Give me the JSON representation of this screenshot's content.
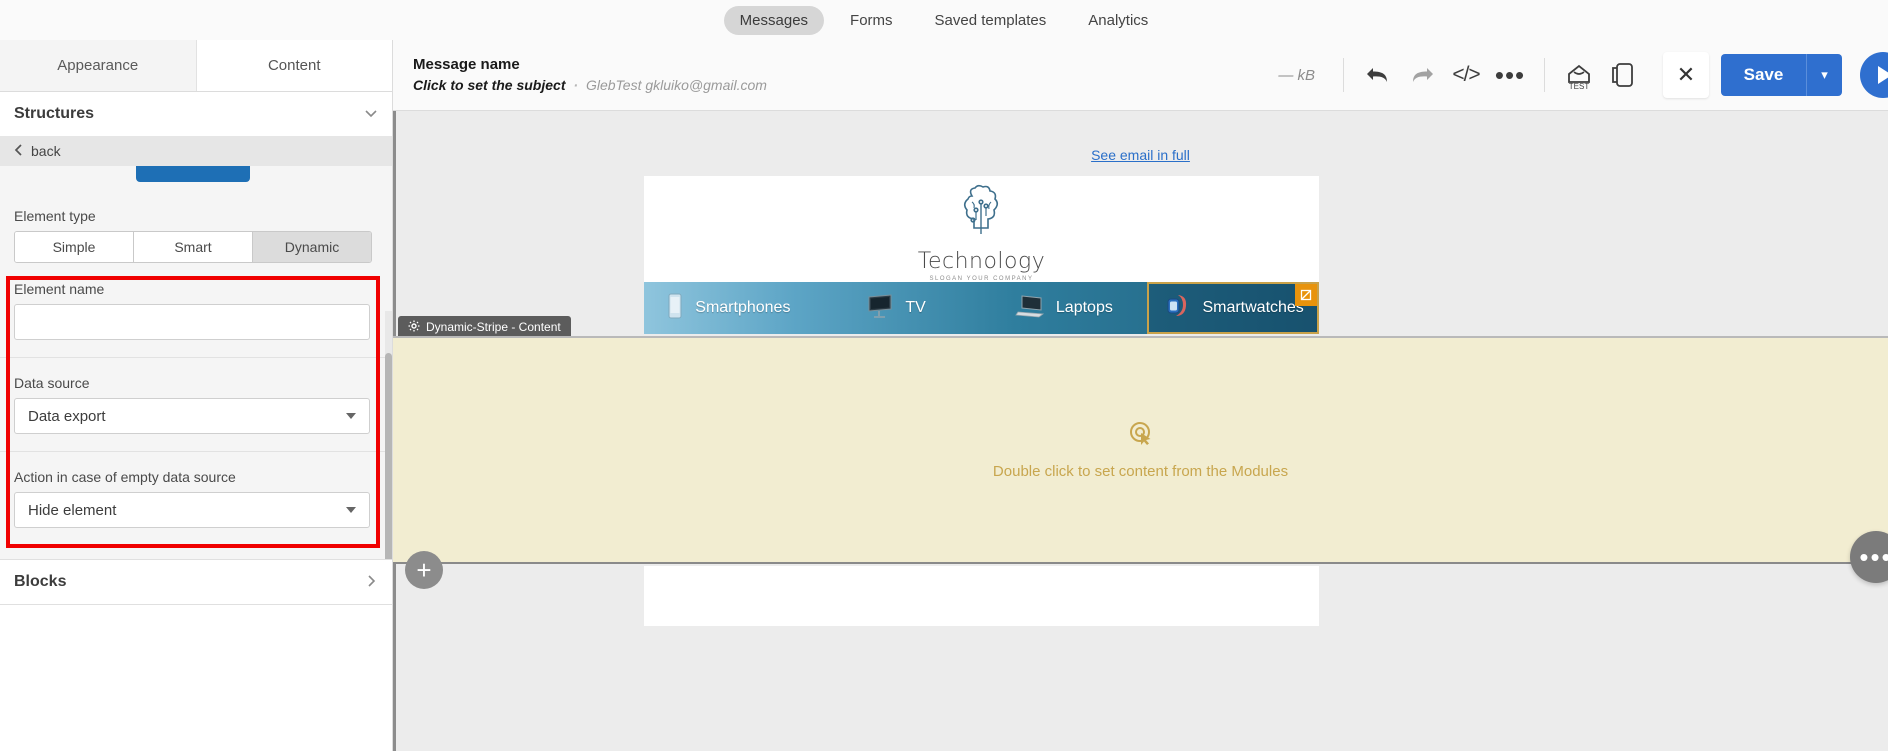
{
  "topnav": {
    "items": [
      {
        "label": "Messages",
        "active": true
      },
      {
        "label": "Forms",
        "active": false
      },
      {
        "label": "Saved templates",
        "active": false
      },
      {
        "label": "Analytics",
        "active": false
      }
    ]
  },
  "left_panel": {
    "tabs": [
      {
        "label": "Appearance",
        "active": false
      },
      {
        "label": "Content",
        "active": true
      }
    ],
    "structures_title": "Structures",
    "back_label": "back",
    "back_icon": "chevron-left-icon",
    "collapse_icon": "chevron-down-icon",
    "element_type": {
      "label": "Element type",
      "options": [
        "Simple",
        "Smart",
        "Dynamic"
      ],
      "selected": "Dynamic"
    },
    "element_name": {
      "label": "Element name",
      "value": "",
      "placeholder": ""
    },
    "data_source": {
      "label": "Data source",
      "value": "Data export"
    },
    "empty_action": {
      "label": "Action in case of empty data source",
      "value": "Hide element"
    },
    "blocks": {
      "label": "Blocks",
      "icon": "chevron-right-icon"
    },
    "highlight_color": "#f00000"
  },
  "editor": {
    "toolbar": {
      "message_name": "Message name",
      "subject_prompt": "Click to set the subject",
      "separator": "·",
      "sender": "GlebTest gkluiko@gmail.com",
      "size": "— kB",
      "icons": [
        {
          "name": "undo-icon",
          "label": "Undo"
        },
        {
          "name": "redo-icon",
          "label": "Redo"
        },
        {
          "name": "code-icon",
          "label": "</>"
        },
        {
          "name": "more-options-icon",
          "label": "…"
        },
        {
          "name": "test-icon",
          "label": "TEST"
        },
        {
          "name": "mobile-preview-icon",
          "label": "Mobile preview"
        }
      ],
      "close_label": "✕",
      "save_label": "Save",
      "save_caret": "▾",
      "play_label": "Send",
      "accent_color": "#2f6fcf"
    },
    "canvas": {
      "see_email_in_full": "See email in full",
      "email": {
        "brand_name": "Technology",
        "slogan": "SLOGAN YOUR COMPANY",
        "logo_icon": "brain-circuit-logo-icon",
        "nav": [
          {
            "label": "Smartphones",
            "icon": "smartphone-icon",
            "selected": false
          },
          {
            "label": "TV",
            "icon": "tv-icon",
            "selected": false
          },
          {
            "label": "Laptops",
            "icon": "laptop-icon",
            "selected": false
          },
          {
            "label": "Smartwatches",
            "icon": "smartwatch-icon",
            "selected": true,
            "badge_icon": "no-edit-icon"
          }
        ]
      },
      "dynamic_block": {
        "tag_label": "Dynamic-Stripe - Content",
        "tag_icon": "gear-icon",
        "hint_text": "Double click to set content from the Modules",
        "hint_icon": "click-target-icon",
        "background_color": "#f2edd1",
        "text_color": "#c8a64e"
      },
      "add_block_label": "+",
      "more_actions_label": "…"
    }
  }
}
